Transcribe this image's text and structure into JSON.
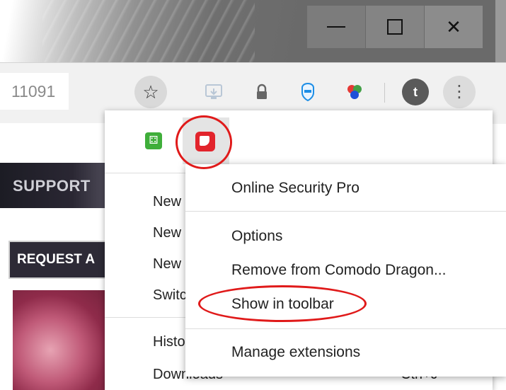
{
  "window": {
    "minimize_symbol": "",
    "maximize_symbol": "",
    "close_symbol": "✕"
  },
  "toolbar": {
    "address_text": "11091",
    "bookmark_star": "☆",
    "profile_initial": "t",
    "menu_dots": "⋮",
    "icons": [
      "cast-icon",
      "lock-icon",
      "shield-icon",
      "color-dots-icon"
    ]
  },
  "page": {
    "nav_label": "SUPPORT",
    "request_label": "REQUEST A"
  },
  "main_menu": {
    "items": [
      {
        "label": "New"
      },
      {
        "label": "New"
      },
      {
        "label": "New"
      },
      {
        "label": "Switc"
      },
      {
        "label": "Histo"
      },
      {
        "label": "Downloads",
        "shortcut": "Ctrl+J"
      }
    ]
  },
  "submenu": {
    "title": "Online Security Pro",
    "options": "Options",
    "remove": "Remove from Comodo Dragon...",
    "show_toolbar": "Show in toolbar",
    "manage": "Manage extensions"
  },
  "annotation_color": "#e01a1a"
}
